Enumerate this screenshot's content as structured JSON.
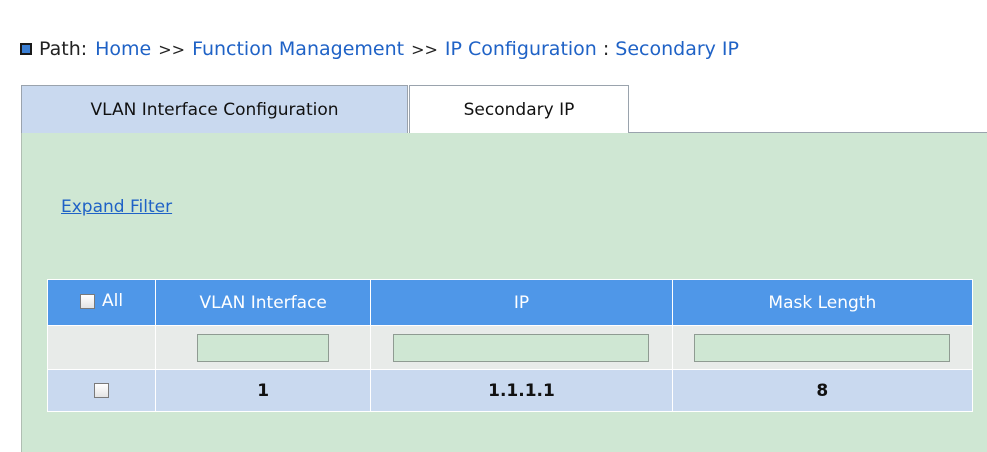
{
  "breadcrumb": {
    "label": "Path:",
    "items": [
      "Home",
      "Function Management",
      "IP Configuration",
      "Secondary IP"
    ],
    "separator": ">>",
    "last_separator": ":"
  },
  "tabs": [
    {
      "label": "VLAN Interface Configuration",
      "active": false
    },
    {
      "label": "Secondary IP",
      "active": true
    }
  ],
  "expand_filter_label": "Expand Filter",
  "table": {
    "select_all_label": "All",
    "columns": [
      "VLAN Interface",
      "IP",
      "Mask Length"
    ],
    "filters": [
      "",
      "",
      ""
    ],
    "rows": [
      {
        "checked": false,
        "vlan_interface": "1",
        "ip": "1.1.1.1",
        "mask_length": "8"
      }
    ]
  },
  "colors": {
    "header_bg": "#4f97e8",
    "panel_bg": "#cfe7d3",
    "tab_inactive_bg": "#c9d9ef",
    "row_bg": "#c9d9ef",
    "link": "#1f62c6"
  }
}
